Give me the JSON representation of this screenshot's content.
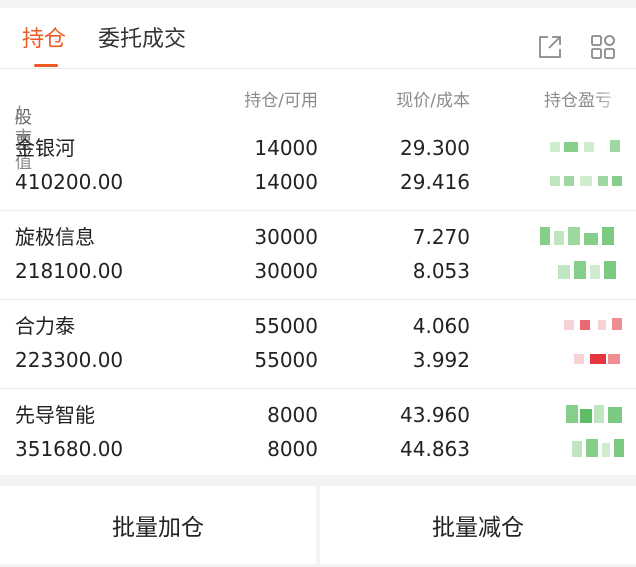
{
  "tabs": {
    "active": "持仓",
    "other": "委托成交"
  },
  "header": {
    "stock": "股票",
    "market_value": "/市值",
    "hold_avail": "持仓/可用",
    "price_cost": "现价/成本",
    "profit_loss": "持仓盈亏"
  },
  "rows": [
    {
      "name": "金银河",
      "market_value": "410200.00",
      "qty": "14000",
      "avail": "14000",
      "price": "29.300",
      "cost": "29.416",
      "pl_color": "#35b34a"
    },
    {
      "name": "旋极信息",
      "market_value": "218100.00",
      "qty": "30000",
      "avail": "30000",
      "price": "7.270",
      "cost": "8.053",
      "pl_color": "#35b34a"
    },
    {
      "name": "合力泰",
      "market_value": "223300.00",
      "qty": "55000",
      "avail": "55000",
      "price": "4.060",
      "cost": "3.992",
      "pl_color": "#e8343e"
    },
    {
      "name": "先导智能",
      "market_value": "351680.00",
      "qty": "8000",
      "avail": "8000",
      "price": "43.960",
      "cost": "44.863",
      "pl_color": "#35b34a"
    }
  ],
  "buttons": {
    "batch_add": "批量加仓",
    "batch_reduce": "批量减仓"
  },
  "colors": {
    "accent": "#ee5a24",
    "gain": "#e8343e",
    "loss": "#35b34a"
  }
}
